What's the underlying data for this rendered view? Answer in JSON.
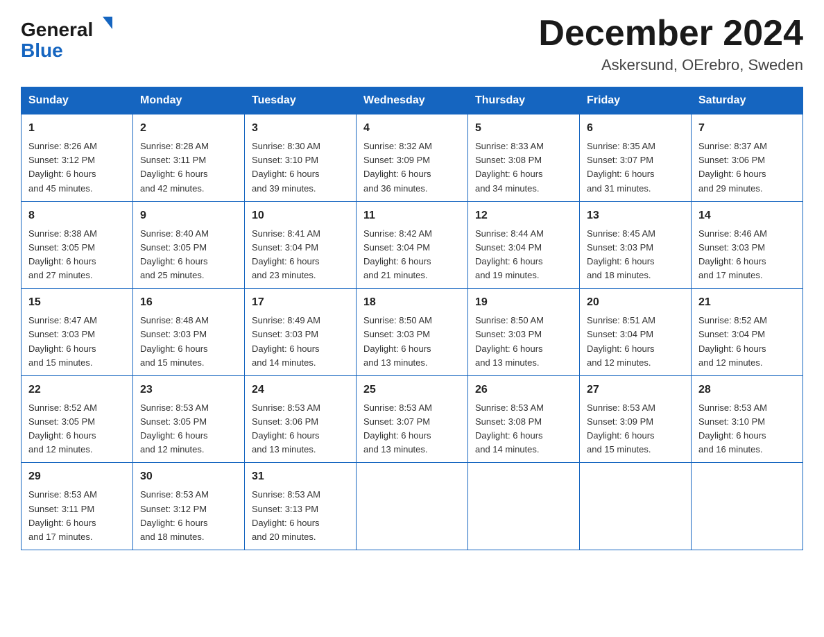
{
  "header": {
    "logo_general": "General",
    "logo_blue": "Blue",
    "month_title": "December 2024",
    "location": "Askersund, OErebro, Sweden"
  },
  "days_of_week": [
    "Sunday",
    "Monday",
    "Tuesday",
    "Wednesday",
    "Thursday",
    "Friday",
    "Saturday"
  ],
  "weeks": [
    [
      {
        "day": "1",
        "sunrise": "8:26 AM",
        "sunset": "3:12 PM",
        "daylight": "6 hours and 45 minutes."
      },
      {
        "day": "2",
        "sunrise": "8:28 AM",
        "sunset": "3:11 PM",
        "daylight": "6 hours and 42 minutes."
      },
      {
        "day": "3",
        "sunrise": "8:30 AM",
        "sunset": "3:10 PM",
        "daylight": "6 hours and 39 minutes."
      },
      {
        "day": "4",
        "sunrise": "8:32 AM",
        "sunset": "3:09 PM",
        "daylight": "6 hours and 36 minutes."
      },
      {
        "day": "5",
        "sunrise": "8:33 AM",
        "sunset": "3:08 PM",
        "daylight": "6 hours and 34 minutes."
      },
      {
        "day": "6",
        "sunrise": "8:35 AM",
        "sunset": "3:07 PM",
        "daylight": "6 hours and 31 minutes."
      },
      {
        "day": "7",
        "sunrise": "8:37 AM",
        "sunset": "3:06 PM",
        "daylight": "6 hours and 29 minutes."
      }
    ],
    [
      {
        "day": "8",
        "sunrise": "8:38 AM",
        "sunset": "3:05 PM",
        "daylight": "6 hours and 27 minutes."
      },
      {
        "day": "9",
        "sunrise": "8:40 AM",
        "sunset": "3:05 PM",
        "daylight": "6 hours and 25 minutes."
      },
      {
        "day": "10",
        "sunrise": "8:41 AM",
        "sunset": "3:04 PM",
        "daylight": "6 hours and 23 minutes."
      },
      {
        "day": "11",
        "sunrise": "8:42 AM",
        "sunset": "3:04 PM",
        "daylight": "6 hours and 21 minutes."
      },
      {
        "day": "12",
        "sunrise": "8:44 AM",
        "sunset": "3:04 PM",
        "daylight": "6 hours and 19 minutes."
      },
      {
        "day": "13",
        "sunrise": "8:45 AM",
        "sunset": "3:03 PM",
        "daylight": "6 hours and 18 minutes."
      },
      {
        "day": "14",
        "sunrise": "8:46 AM",
        "sunset": "3:03 PM",
        "daylight": "6 hours and 17 minutes."
      }
    ],
    [
      {
        "day": "15",
        "sunrise": "8:47 AM",
        "sunset": "3:03 PM",
        "daylight": "6 hours and 15 minutes."
      },
      {
        "day": "16",
        "sunrise": "8:48 AM",
        "sunset": "3:03 PM",
        "daylight": "6 hours and 15 minutes."
      },
      {
        "day": "17",
        "sunrise": "8:49 AM",
        "sunset": "3:03 PM",
        "daylight": "6 hours and 14 minutes."
      },
      {
        "day": "18",
        "sunrise": "8:50 AM",
        "sunset": "3:03 PM",
        "daylight": "6 hours and 13 minutes."
      },
      {
        "day": "19",
        "sunrise": "8:50 AM",
        "sunset": "3:03 PM",
        "daylight": "6 hours and 13 minutes."
      },
      {
        "day": "20",
        "sunrise": "8:51 AM",
        "sunset": "3:04 PM",
        "daylight": "6 hours and 12 minutes."
      },
      {
        "day": "21",
        "sunrise": "8:52 AM",
        "sunset": "3:04 PM",
        "daylight": "6 hours and 12 minutes."
      }
    ],
    [
      {
        "day": "22",
        "sunrise": "8:52 AM",
        "sunset": "3:05 PM",
        "daylight": "6 hours and 12 minutes."
      },
      {
        "day": "23",
        "sunrise": "8:53 AM",
        "sunset": "3:05 PM",
        "daylight": "6 hours and 12 minutes."
      },
      {
        "day": "24",
        "sunrise": "8:53 AM",
        "sunset": "3:06 PM",
        "daylight": "6 hours and 13 minutes."
      },
      {
        "day": "25",
        "sunrise": "8:53 AM",
        "sunset": "3:07 PM",
        "daylight": "6 hours and 13 minutes."
      },
      {
        "day": "26",
        "sunrise": "8:53 AM",
        "sunset": "3:08 PM",
        "daylight": "6 hours and 14 minutes."
      },
      {
        "day": "27",
        "sunrise": "8:53 AM",
        "sunset": "3:09 PM",
        "daylight": "6 hours and 15 minutes."
      },
      {
        "day": "28",
        "sunrise": "8:53 AM",
        "sunset": "3:10 PM",
        "daylight": "6 hours and 16 minutes."
      }
    ],
    [
      {
        "day": "29",
        "sunrise": "8:53 AM",
        "sunset": "3:11 PM",
        "daylight": "6 hours and 17 minutes."
      },
      {
        "day": "30",
        "sunrise": "8:53 AM",
        "sunset": "3:12 PM",
        "daylight": "6 hours and 18 minutes."
      },
      {
        "day": "31",
        "sunrise": "8:53 AM",
        "sunset": "3:13 PM",
        "daylight": "6 hours and 20 minutes."
      },
      null,
      null,
      null,
      null
    ]
  ],
  "labels": {
    "sunrise": "Sunrise:",
    "sunset": "Sunset:",
    "daylight": "Daylight:"
  }
}
